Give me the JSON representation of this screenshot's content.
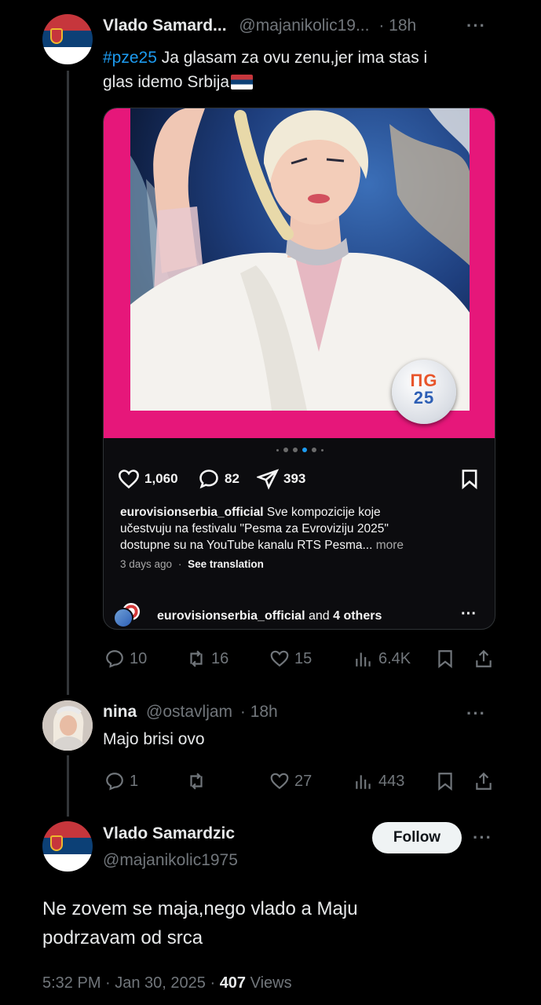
{
  "tweet1": {
    "name": "Vlado Samard...",
    "handle": "@majanikolic19...",
    "time": "· 18h",
    "more": "···",
    "hashtag": "#pze25",
    "text_line1": " Ja glasam za ovu zenu,jer ima stas i",
    "text_line2": "glas idemo Srbija",
    "flag_emoji": "serbian-flag-icon",
    "embed": {
      "likes": "1,060",
      "comments": "82",
      "shares": "393",
      "caption_user": "eurovisionserbia_official",
      "caption_text_1": " Sve kompozicije koje",
      "caption_text_2": "učestvuju na festivalu \"Pesma za Evroviziju 2025\"",
      "caption_text_3": "dostupne su na YouTube kanalu RTS Pesma...",
      "caption_more": " more",
      "ago": "3 days ago",
      "see_translation": "See translation",
      "footer_user": "eurovisionserbia_official",
      "footer_and": " and ",
      "footer_others": "4 others",
      "footer_more": "···",
      "badge_line1": "ПG",
      "badge_line2": "25",
      "carousel_dots": 6,
      "carousel_active": 3
    },
    "actions": {
      "replies": "10",
      "reposts": "16",
      "likes": "15",
      "views": "6.4K"
    }
  },
  "reply": {
    "name": "nina",
    "handle": "@ostavljam",
    "time": "· 18h",
    "more": "···",
    "text": "Majo brisi ovo",
    "actions": {
      "replies": "1",
      "reposts": "",
      "likes": "27",
      "views": "443"
    }
  },
  "main_tweet": {
    "name": "Vlado Samardzic",
    "handle": "@majanikolic1975",
    "follow_label": "Follow",
    "more": "···",
    "text_line1": "Ne zovem se maja,nego vlado a Maju",
    "text_line2": "podrzavam od srca",
    "meta_time": "5:32 PM · Jan 30, 2025 · ",
    "meta_views_count": "407",
    "meta_views_label": " Views"
  },
  "colors": {
    "background": "#000000",
    "accent": "#1d9bf0",
    "embed_pink": "#e6177a",
    "text": "#e7e9ea",
    "muted": "#71767b"
  }
}
